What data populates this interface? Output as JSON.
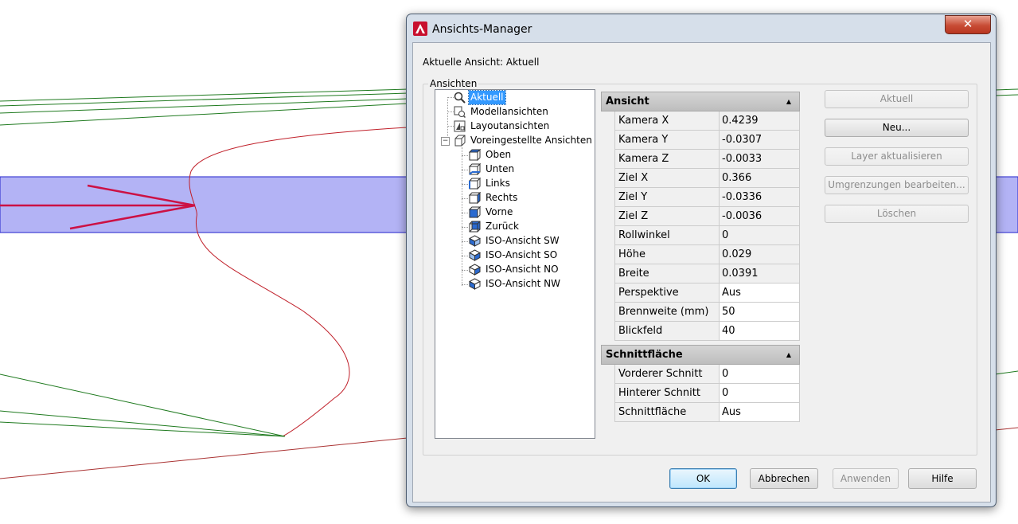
{
  "dialog": {
    "title": "Ansichts-Manager",
    "close_label": "✕",
    "current_view_label": "Aktuelle Ansicht: Aktuell",
    "group_label": "Ansichten"
  },
  "tree": {
    "root_items": [
      {
        "label": "Aktuell",
        "icon": "magnifier-icon",
        "selected": true
      },
      {
        "label": "Modellansichten",
        "icon": "model-views-icon"
      },
      {
        "label": "Layoutansichten",
        "icon": "layout-views-icon"
      },
      {
        "label": "Voreingestellte Ansichten",
        "icon": "preset-views-icon",
        "expanded": true
      }
    ],
    "preset_children": [
      {
        "label": "Oben",
        "icon": "cube-top-icon"
      },
      {
        "label": "Unten",
        "icon": "cube-bottom-icon"
      },
      {
        "label": "Links",
        "icon": "cube-left-icon"
      },
      {
        "label": "Rechts",
        "icon": "cube-right-icon"
      },
      {
        "label": "Vorne",
        "icon": "cube-front-icon"
      },
      {
        "label": "Zurück",
        "icon": "cube-back-icon"
      },
      {
        "label": "ISO-Ansicht SW",
        "icon": "iso-cube-icon"
      },
      {
        "label": "ISO-Ansicht SO",
        "icon": "iso-cube-icon"
      },
      {
        "label": "ISO-Ansicht NO",
        "icon": "iso-cube-icon"
      },
      {
        "label": "ISO-Ansicht NW",
        "icon": "iso-cube-icon"
      }
    ]
  },
  "properties": {
    "section_view": "Ansicht",
    "view_rows": [
      {
        "name": "Kamera X",
        "value": "0.4239"
      },
      {
        "name": "Kamera Y",
        "value": "-0.0307"
      },
      {
        "name": "Kamera Z",
        "value": "-0.0033"
      },
      {
        "name": "Ziel X",
        "value": "0.366"
      },
      {
        "name": "Ziel Y",
        "value": "-0.0336"
      },
      {
        "name": "Ziel Z",
        "value": "-0.0036"
      },
      {
        "name": "Rollwinkel",
        "value": "0"
      },
      {
        "name": "Höhe",
        "value": "0.029"
      },
      {
        "name": "Breite",
        "value": "0.0391"
      },
      {
        "name": "Perspektive",
        "value": "Aus",
        "editable": true
      },
      {
        "name": "Brennweite (mm)",
        "value": "50",
        "editable": true
      },
      {
        "name": "Blickfeld",
        "value": "40",
        "editable": true
      }
    ],
    "section_clip": "Schnittfläche",
    "clip_rows": [
      {
        "name": "Vorderer Schnitt",
        "value": "0",
        "editable": true
      },
      {
        "name": "Hinterer Schnitt",
        "value": "0",
        "editable": true
      },
      {
        "name": "Schnittfläche",
        "value": "Aus",
        "editable": true
      }
    ]
  },
  "side_buttons": {
    "set_current": "Aktuell",
    "new": "Neu...",
    "update_layers": "Layer aktualisieren",
    "edit_boundaries": "Umgrenzungen bearbeiten...",
    "delete": "Löschen"
  },
  "bottom_buttons": {
    "ok": "OK",
    "cancel": "Abbrechen",
    "apply": "Anwenden",
    "help": "Hilfe"
  },
  "colors": {
    "selection": "#3399ff",
    "highlight_band": "#b3b3f5",
    "arrow": "#cc1144",
    "curve": "#c0202a",
    "green_lines": "#1f7a1f"
  }
}
